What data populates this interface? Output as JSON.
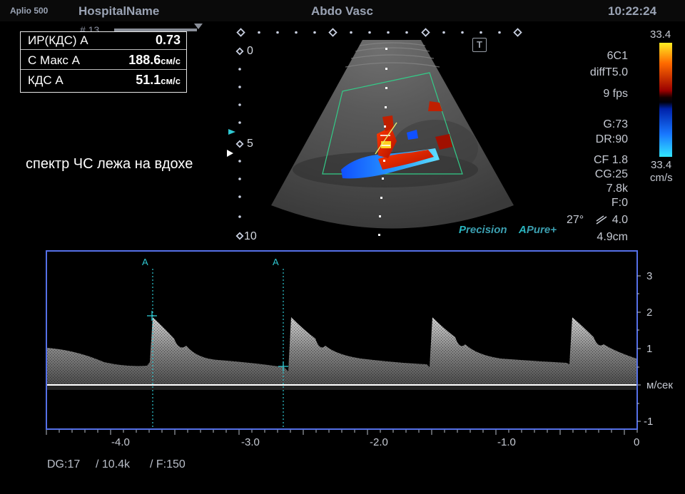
{
  "header": {
    "model": "Aplio 500",
    "hospital": "HospitalName",
    "preset": "Abdo Vasc",
    "time": "10:22:24"
  },
  "frame_no": "# 13",
  "measurements": [
    {
      "label": "ИР(КДС) А",
      "value": "0.73",
      "unit": ""
    },
    {
      "label": "С Макс А",
      "value": "188.6",
      "unit": "см/с"
    },
    {
      "label": "КДС А",
      "value": "51.1",
      "unit": "см/с"
    }
  ],
  "annotation": "спектр ЧС лежа на вдохе",
  "depth_scale": {
    "d0": "0",
    "d5": "5",
    "d10": "10"
  },
  "transducer": "6C1",
  "mode": "diffT5.0",
  "fps": "9 fps",
  "gain": "G:73",
  "dynamic_range": "DR:90",
  "color_flow": "CF 1.8",
  "color_gain": "CG:25",
  "prf": "7.8k",
  "filter": "F:0",
  "angle": "27°",
  "angle_val": "4.0",
  "depth": "4.9cm",
  "color_scale": {
    "max": "33.4",
    "min": "33.4",
    "unit": "cm/s"
  },
  "brand": {
    "precision_p": "P",
    "precision_rest": "recision",
    "pure_a": "A",
    "pure_rest": "Pure+"
  },
  "spectrum": {
    "y_ticks": [
      "3",
      "2",
      "1",
      "м/сек",
      "-1"
    ],
    "x_ticks": [
      "-4.0",
      "-3.0",
      "-2.0",
      "-1.0",
      "0"
    ],
    "markers": [
      "A",
      "A"
    ],
    "footer": {
      "dg": "DG:17",
      "prf": "/ 10.4k",
      "filter": "/ F:150"
    }
  },
  "colors": {
    "accent": "#5570e8",
    "frame_text": "#9aa3b4",
    "marker": "#2fc8d2"
  }
}
